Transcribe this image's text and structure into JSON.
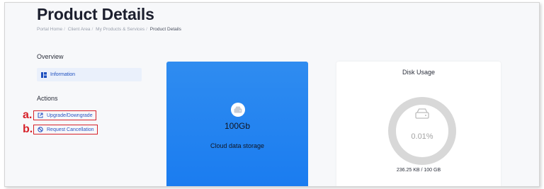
{
  "page": {
    "title": "Product Details",
    "breadcrumb": [
      "Portal Home",
      "Client Area",
      "My Products & Services",
      "Product Details"
    ]
  },
  "sidebar": {
    "overview_label": "Overview",
    "overview_items": [
      {
        "label": "Information",
        "icon": "grid-icon"
      }
    ],
    "actions_label": "Actions",
    "actions": [
      {
        "marker": "a.",
        "label": "Upgrade/Downgrade",
        "icon": "external-link-icon"
      },
      {
        "marker": "b.",
        "label": "Request Cancellation",
        "icon": "cancel-icon"
      }
    ]
  },
  "product_card": {
    "size": "100Gb",
    "description": "Cloud data storage",
    "icon": "hard-drive-icon",
    "color": "#1a7cf0"
  },
  "disk_usage": {
    "title": "Disk Usage",
    "percent": "0.01%",
    "usage": "236.25 KB / 100 GB",
    "icon": "hard-drive-icon"
  },
  "colors": {
    "annotation_red": "#d7222a",
    "link_blue": "#2b56c4"
  }
}
